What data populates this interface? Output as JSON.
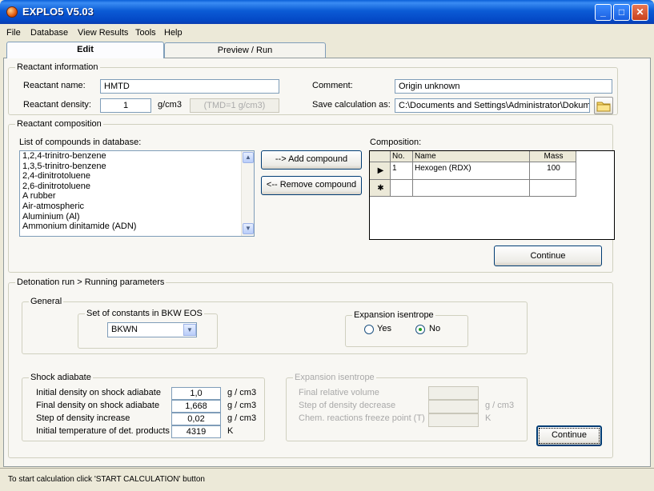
{
  "window": {
    "title": "EXPLO5 V5.03",
    "min": "_",
    "max": "□",
    "close": "✕"
  },
  "menu": [
    "File",
    "Database",
    "View Results",
    "Tools",
    "Help"
  ],
  "tabs": {
    "edit": "Edit",
    "preview": "Preview / Run"
  },
  "reactant_info": {
    "legend": "Reactant information",
    "name_label": "Reactant name:",
    "name_value": "HMTD",
    "density_label": "Reactant density:",
    "density_value": "1",
    "density_unit": "g/cm3",
    "tmd_text": "(TMD=1 g/cm3)",
    "comment_label": "Comment:",
    "comment_value": "Origin unknown",
    "save_label": "Save calculation as:",
    "save_value": "C:\\Documents and Settings\\Administrator\\Dokum"
  },
  "composition": {
    "legend": "Reactant composition",
    "list_label": "List of compounds in database:",
    "compounds": [
      "1,2,4-trinitro-benzene",
      "1,3,5-trinitro-benzene",
      "2,4-dinitrotoluene",
      "2,6-dinitrotoluene",
      "A rubber",
      "Air-atmospheric",
      "Aluminium (Al)",
      "Ammonium dinitamide (ADN)"
    ],
    "add_button": "--> Add compound",
    "remove_button": "<-- Remove compound",
    "grid_label": "Composition:",
    "grid_headers": {
      "no": "No.",
      "name": "Name",
      "mass": "Mass"
    },
    "grid_rows": [
      {
        "no": "1",
        "name": "Hexogen (RDX)",
        "mass": "100"
      }
    ],
    "continue_button": "Continue"
  },
  "detonation": {
    "legend": "Detonation run > Running parameters",
    "general_legend": "General",
    "bkw_legend": "Set of constants in BKW EOS",
    "bkw_value": "BKWN",
    "expansion_legend": "Expansion isentrope",
    "yes_label": "Yes",
    "no_label": "No",
    "selected": "No",
    "shock_legend": "Shock adiabate",
    "shock_rows": [
      {
        "label": "Initial density on shock adiabate",
        "value": "1,0",
        "unit": "g / cm3"
      },
      {
        "label": "Final density on shock adiabate",
        "value": "1,668",
        "unit": "g / cm3"
      },
      {
        "label": "Step of density increase",
        "value": "0,02",
        "unit": "g / cm3"
      },
      {
        "label": "Initial temperature of det. products",
        "value": "4319",
        "unit": "K"
      }
    ],
    "iso_legend": "Expansion isentrope",
    "iso_rows": [
      {
        "label": "Final relative volume",
        "unit": ""
      },
      {
        "label": "Step of density decrease",
        "unit": "g / cm3"
      },
      {
        "label": "Chem. reactions freeze point (T)",
        "unit": "K"
      }
    ],
    "continue_button": "Continue"
  },
  "status": {
    "text": "To start calculation click 'START CALCULATION' button"
  }
}
